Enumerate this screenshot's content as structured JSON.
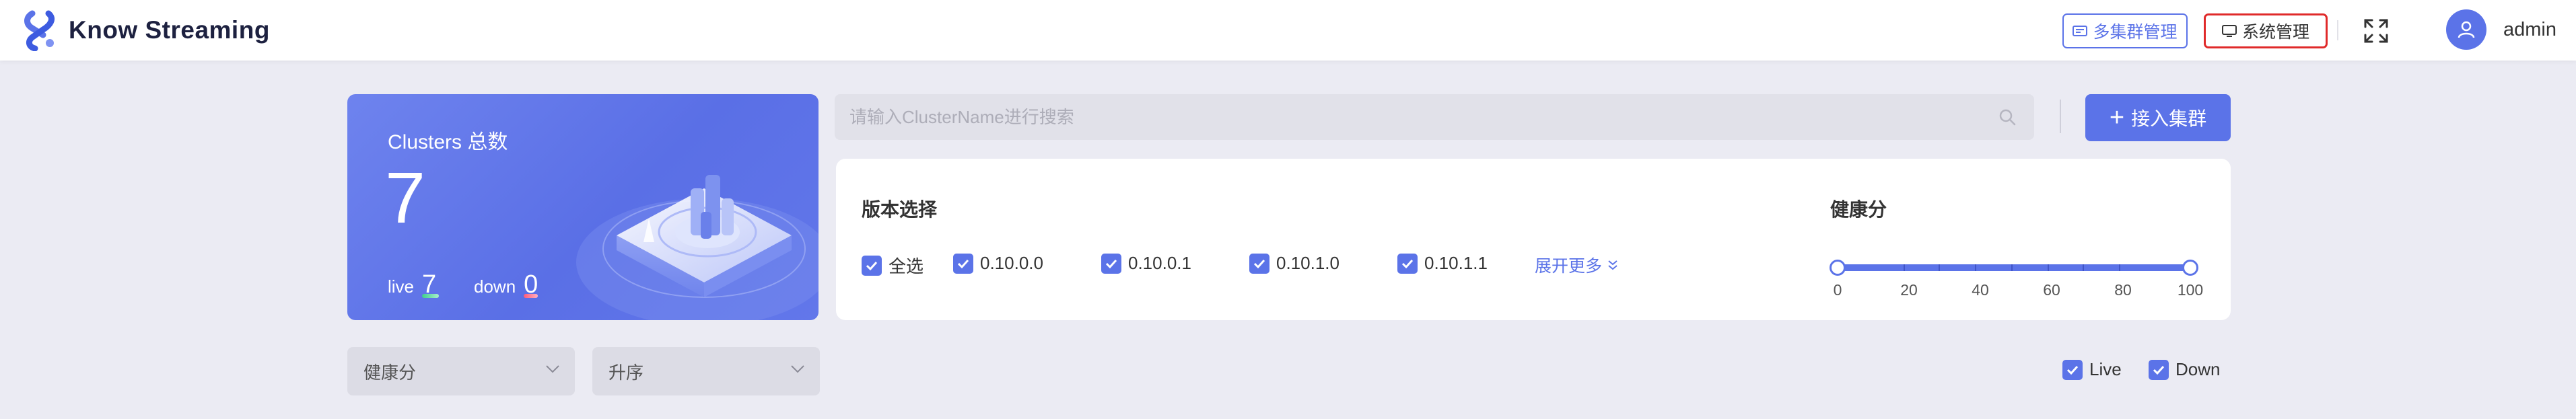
{
  "header": {
    "brand": "Know Streaming",
    "multi_cluster_label": "多集群管理",
    "system_manage_label": "系统管理",
    "username": "admin"
  },
  "clusters_card": {
    "title": "Clusters 总数",
    "total": "7",
    "live_label": "live",
    "live_count": "7",
    "down_label": "down",
    "down_count": "0"
  },
  "search": {
    "placeholder": "请输入ClusterName进行搜索",
    "value": ""
  },
  "add_cluster_label": "接入集群",
  "filters": {
    "version_title": "版本选择",
    "select_all_label": "全选",
    "versions": [
      "0.10.0.0",
      "0.10.0.1",
      "0.10.1.0",
      "0.10.1.1"
    ],
    "expand_more_label": "展开更多",
    "health_title": "健康分",
    "health_range": [
      0,
      100
    ],
    "health_marks": [
      "0",
      "20",
      "40",
      "60",
      "80",
      "100"
    ]
  },
  "sort": {
    "field_value": "健康分",
    "order_value": "升序"
  },
  "status_filters": {
    "live_label": "Live",
    "down_label": "Down"
  },
  "colors": {
    "accent": "#5b73e8",
    "highlight_border": "#e02a2a",
    "page_bg": "#ebebf3"
  }
}
